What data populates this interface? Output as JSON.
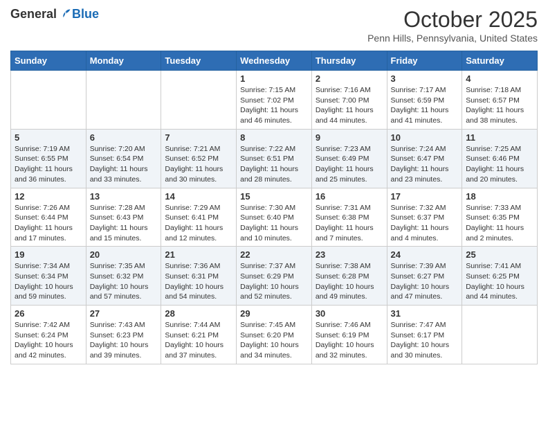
{
  "header": {
    "logo_general": "General",
    "logo_blue": "Blue",
    "month_title": "October 2025",
    "location": "Penn Hills, Pennsylvania, United States"
  },
  "days_of_week": [
    "Sunday",
    "Monday",
    "Tuesday",
    "Wednesday",
    "Thursday",
    "Friday",
    "Saturday"
  ],
  "weeks": [
    [
      {
        "day": "",
        "info": ""
      },
      {
        "day": "",
        "info": ""
      },
      {
        "day": "",
        "info": ""
      },
      {
        "day": "1",
        "info": "Sunrise: 7:15 AM\nSunset: 7:02 PM\nDaylight: 11 hours and 46 minutes."
      },
      {
        "day": "2",
        "info": "Sunrise: 7:16 AM\nSunset: 7:00 PM\nDaylight: 11 hours and 44 minutes."
      },
      {
        "day": "3",
        "info": "Sunrise: 7:17 AM\nSunset: 6:59 PM\nDaylight: 11 hours and 41 minutes."
      },
      {
        "day": "4",
        "info": "Sunrise: 7:18 AM\nSunset: 6:57 PM\nDaylight: 11 hours and 38 minutes."
      }
    ],
    [
      {
        "day": "5",
        "info": "Sunrise: 7:19 AM\nSunset: 6:55 PM\nDaylight: 11 hours and 36 minutes."
      },
      {
        "day": "6",
        "info": "Sunrise: 7:20 AM\nSunset: 6:54 PM\nDaylight: 11 hours and 33 minutes."
      },
      {
        "day": "7",
        "info": "Sunrise: 7:21 AM\nSunset: 6:52 PM\nDaylight: 11 hours and 30 minutes."
      },
      {
        "day": "8",
        "info": "Sunrise: 7:22 AM\nSunset: 6:51 PM\nDaylight: 11 hours and 28 minutes."
      },
      {
        "day": "9",
        "info": "Sunrise: 7:23 AM\nSunset: 6:49 PM\nDaylight: 11 hours and 25 minutes."
      },
      {
        "day": "10",
        "info": "Sunrise: 7:24 AM\nSunset: 6:47 PM\nDaylight: 11 hours and 23 minutes."
      },
      {
        "day": "11",
        "info": "Sunrise: 7:25 AM\nSunset: 6:46 PM\nDaylight: 11 hours and 20 minutes."
      }
    ],
    [
      {
        "day": "12",
        "info": "Sunrise: 7:26 AM\nSunset: 6:44 PM\nDaylight: 11 hours and 17 minutes."
      },
      {
        "day": "13",
        "info": "Sunrise: 7:28 AM\nSunset: 6:43 PM\nDaylight: 11 hours and 15 minutes."
      },
      {
        "day": "14",
        "info": "Sunrise: 7:29 AM\nSunset: 6:41 PM\nDaylight: 11 hours and 12 minutes."
      },
      {
        "day": "15",
        "info": "Sunrise: 7:30 AM\nSunset: 6:40 PM\nDaylight: 11 hours and 10 minutes."
      },
      {
        "day": "16",
        "info": "Sunrise: 7:31 AM\nSunset: 6:38 PM\nDaylight: 11 hours and 7 minutes."
      },
      {
        "day": "17",
        "info": "Sunrise: 7:32 AM\nSunset: 6:37 PM\nDaylight: 11 hours and 4 minutes."
      },
      {
        "day": "18",
        "info": "Sunrise: 7:33 AM\nSunset: 6:35 PM\nDaylight: 11 hours and 2 minutes."
      }
    ],
    [
      {
        "day": "19",
        "info": "Sunrise: 7:34 AM\nSunset: 6:34 PM\nDaylight: 10 hours and 59 minutes."
      },
      {
        "day": "20",
        "info": "Sunrise: 7:35 AM\nSunset: 6:32 PM\nDaylight: 10 hours and 57 minutes."
      },
      {
        "day": "21",
        "info": "Sunrise: 7:36 AM\nSunset: 6:31 PM\nDaylight: 10 hours and 54 minutes."
      },
      {
        "day": "22",
        "info": "Sunrise: 7:37 AM\nSunset: 6:29 PM\nDaylight: 10 hours and 52 minutes."
      },
      {
        "day": "23",
        "info": "Sunrise: 7:38 AM\nSunset: 6:28 PM\nDaylight: 10 hours and 49 minutes."
      },
      {
        "day": "24",
        "info": "Sunrise: 7:39 AM\nSunset: 6:27 PM\nDaylight: 10 hours and 47 minutes."
      },
      {
        "day": "25",
        "info": "Sunrise: 7:41 AM\nSunset: 6:25 PM\nDaylight: 10 hours and 44 minutes."
      }
    ],
    [
      {
        "day": "26",
        "info": "Sunrise: 7:42 AM\nSunset: 6:24 PM\nDaylight: 10 hours and 42 minutes."
      },
      {
        "day": "27",
        "info": "Sunrise: 7:43 AM\nSunset: 6:23 PM\nDaylight: 10 hours and 39 minutes."
      },
      {
        "day": "28",
        "info": "Sunrise: 7:44 AM\nSunset: 6:21 PM\nDaylight: 10 hours and 37 minutes."
      },
      {
        "day": "29",
        "info": "Sunrise: 7:45 AM\nSunset: 6:20 PM\nDaylight: 10 hours and 34 minutes."
      },
      {
        "day": "30",
        "info": "Sunrise: 7:46 AM\nSunset: 6:19 PM\nDaylight: 10 hours and 32 minutes."
      },
      {
        "day": "31",
        "info": "Sunrise: 7:47 AM\nSunset: 6:17 PM\nDaylight: 10 hours and 30 minutes."
      },
      {
        "day": "",
        "info": ""
      }
    ]
  ]
}
